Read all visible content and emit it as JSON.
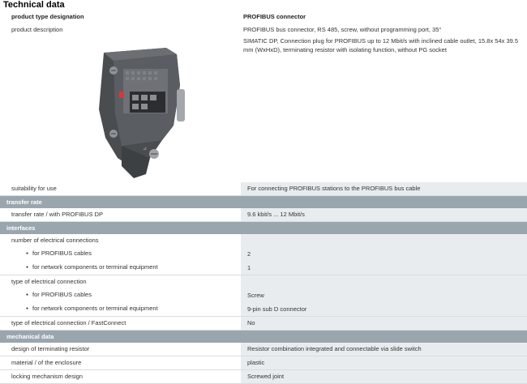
{
  "page_title": "Technical data",
  "rows": {
    "product_type_label": "product type designation",
    "product_type_value": "PROFIBUS connector",
    "product_desc_label": "product description",
    "product_desc_value_1": "PROFIBUS bus connector, RS 485, screw, without programming port, 35°",
    "product_desc_value_2": "SIMATIC DP, Connection plug for PROFIBUS up to 12 Mbit/s with inclined cable outlet, 15.8x 54x 39.5 mm (WxHxD), terminating resistor with isolating function, without PG socket",
    "suitability_label": "suitability for use",
    "suitability_value": "For connecting PROFIBUS stations to the PROFIBUS bus cable"
  },
  "sections": {
    "transfer_rate": "transfer rate",
    "interfaces": "interfaces",
    "mechanical": "mechanical data"
  },
  "transfer": {
    "label": "transfer rate / with PROFIBUS DP",
    "value": "9.6 kbit/s ... 12 Mbit/s"
  },
  "interfaces": {
    "num_conn_label": "number of electrical connections",
    "profibus_cables_label": "for PROFIBUS cables",
    "profibus_cables_value": "2",
    "network_label": "for network components or terminal equipment",
    "network_value": "1",
    "type_conn_label": "type of electrical connection",
    "type_profibus_label": "for PROFIBUS cables",
    "type_profibus_value": "Screw",
    "type_network_label": "for network components or terminal equipment",
    "type_network_value": "9-pin sub D connector",
    "fastconnect_label": "type of electrical connection / FastConnect",
    "fastconnect_value": "No"
  },
  "mechanical": {
    "resistor_label": "design of terminating resistor",
    "resistor_value": "Resistor combination integrated and connectable via slide switch",
    "material_label": "material / of the enclosure",
    "material_value": "plastic",
    "locking_label": "locking mechanism design",
    "locking_value": "Screwed joint"
  }
}
